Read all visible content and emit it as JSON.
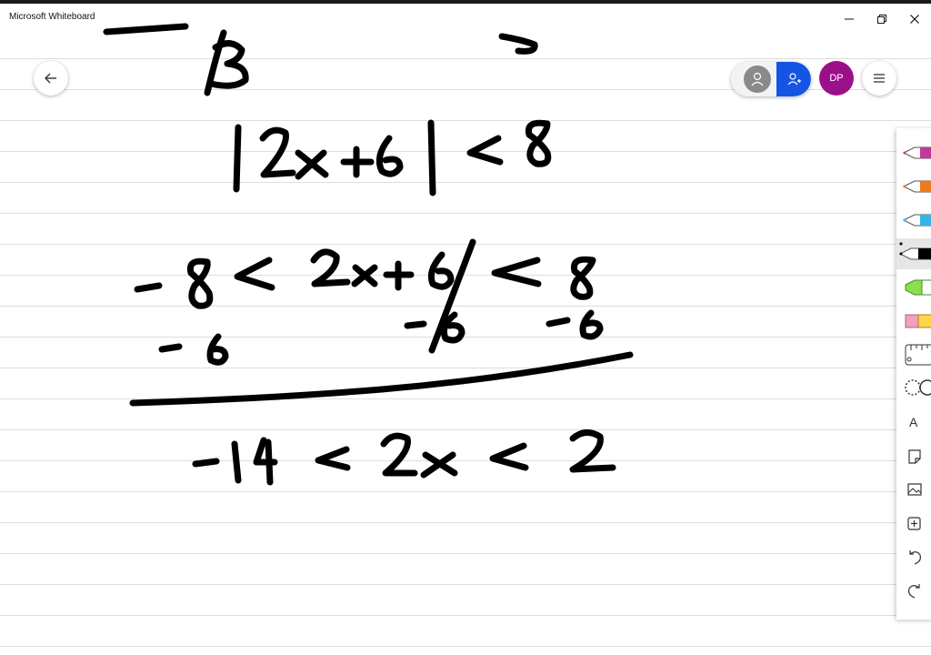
{
  "window": {
    "title": "Microsoft Whiteboard"
  },
  "header": {
    "avatar_initials": "DP"
  },
  "toolbar": {
    "text_tool_label": "A",
    "tools": [
      "magenta-pen",
      "orange-pen",
      "blue-pen",
      "black-pen",
      "green-highlighter",
      "pink-highlighter",
      "ruler",
      "lasso",
      "text",
      "sticky-note",
      "image",
      "add",
      "undo",
      "redo"
    ]
  },
  "colors": {
    "avatar": "#9c0f8a",
    "collaborate": "#1455e5",
    "pen_magenta": "#c0399b",
    "pen_orange": "#f07a1a",
    "pen_blue": "#35b4e8",
    "pen_black": "#000000",
    "highlighter_green": "#8be04a",
    "highlighter_pink": "#f2a0bf"
  },
  "ink": {
    "line1": "|2x+6| < 8",
    "line2": "-8 < 2x+6 < 8",
    "line3": "-6   -6   -6",
    "line4": "-14 < 2x < 2"
  }
}
